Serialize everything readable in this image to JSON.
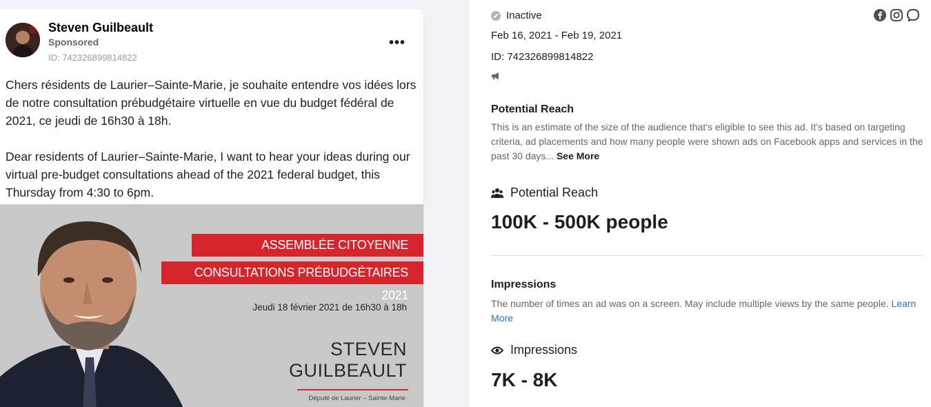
{
  "ad": {
    "advertiser": "Steven Guilbeault",
    "sponsored_label": "Sponsored",
    "id_label": "ID: 742326899814822",
    "more_label": "•••",
    "text_fr": "Chers résidents de Laurier–Sainte-Marie, je souhaite entendre vos idées lors de notre consultation prébudgétaire virtuelle en vue du budget fédéral de 2021, ce jeudi de 16h30 à 18h.",
    "text_en": "Dear residents of Laurier–Sainte-Marie, I want to hear your ideas during our virtual pre-budget consultations ahead of the 2021 federal budget, this Thursday from 4:30 to 6pm.",
    "creative": {
      "banner1": "ASSEMBLÉE CITOYENNE VIRTUELLE",
      "banner2": "CONSULTATIONS PRÉBUDGÉTAIRES 2021",
      "event_date": "Jeudi 18 février 2021 de 16h30 à 18h",
      "first_name": "STEVEN",
      "last_name": "GUILBEAULT",
      "role": "Député de Laurier – Sainte-Marie"
    }
  },
  "details": {
    "status": "Inactive",
    "date_range": "Feb 16, 2021 - Feb 19, 2021",
    "id_label": "ID: 742326899814822",
    "platform_icons": [
      "facebook-icon",
      "instagram-icon",
      "messenger-icon"
    ],
    "potential_reach": {
      "title": "Potential Reach",
      "description": "This is an estimate of the size of the audience that's eligible to see this ad. It's based on targeting criteria, ad placements and how many people were shown ads on Facebook apps and services in the past 30 days...",
      "see_more": "See More",
      "metric_label": "Potential Reach",
      "metric_value": "100K - 500K people"
    },
    "impressions": {
      "title": "Impressions",
      "description": "The number of times an ad was on a screen. May include multiple views by the same people.",
      "learn_more": "Learn More",
      "metric_label": "Impressions",
      "metric_value": "7K - 8K"
    }
  },
  "colors": {
    "banner_red": "#d7252d",
    "link_blue": "#216fdb",
    "muted_text": "#65676b"
  }
}
